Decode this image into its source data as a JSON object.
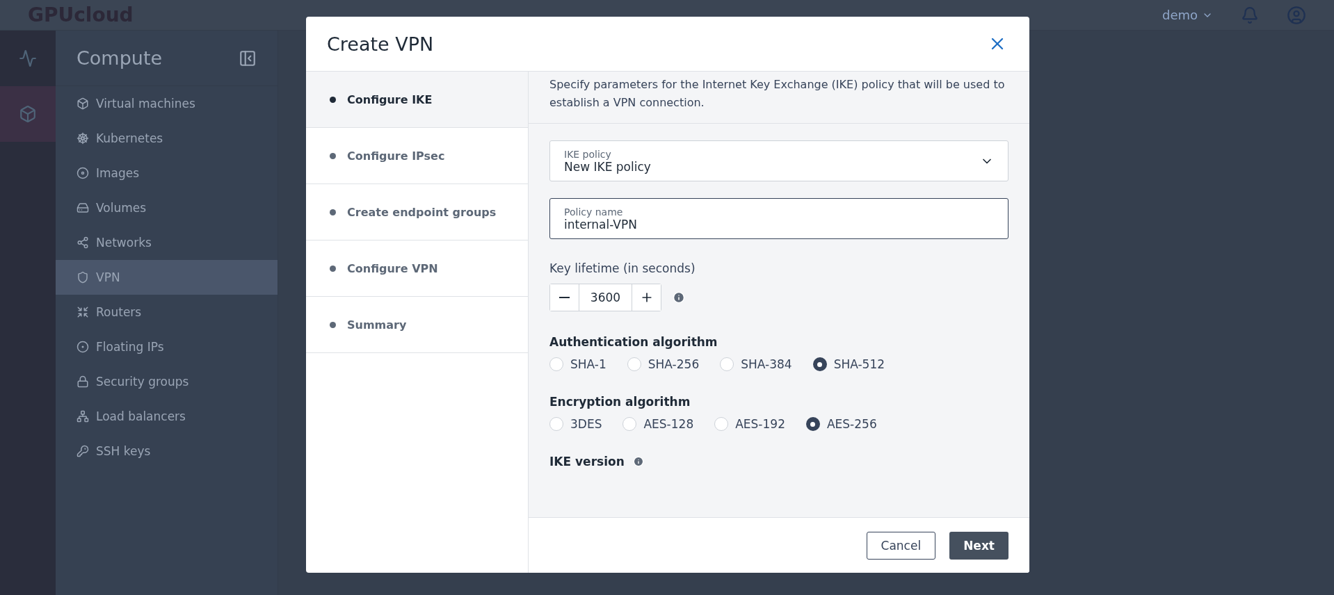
{
  "header": {
    "logo": "GPUcloud",
    "user": "demo"
  },
  "rail": [
    {
      "selected": false
    },
    {
      "selected": true
    }
  ],
  "nav": {
    "title": "Compute",
    "items": [
      {
        "label": "Virtual machines",
        "selected": false
      },
      {
        "label": "Kubernetes",
        "selected": false
      },
      {
        "label": "Images",
        "selected": false
      },
      {
        "label": "Volumes",
        "selected": false
      },
      {
        "label": "Networks",
        "selected": false
      },
      {
        "label": "VPN",
        "selected": true
      },
      {
        "label": "Routers",
        "selected": false
      },
      {
        "label": "Floating IPs",
        "selected": false
      },
      {
        "label": "Security groups",
        "selected": false
      },
      {
        "label": "Load balancers",
        "selected": false
      },
      {
        "label": "SSH keys",
        "selected": false
      }
    ]
  },
  "modal": {
    "title": "Create VPN",
    "steps": [
      {
        "label": "Configure IKE",
        "selected": true
      },
      {
        "label": "Configure IPsec",
        "selected": false
      },
      {
        "label": "Create endpoint groups",
        "selected": false
      },
      {
        "label": "Configure VPN",
        "selected": false
      },
      {
        "label": "Summary",
        "selected": false
      }
    ],
    "description": "Specify parameters for the Internet Key Exchange (IKE) policy that will be used to establish a VPN connection.",
    "ike_policy": {
      "label": "IKE policy",
      "value": "New IKE policy"
    },
    "policy_name": {
      "label": "Policy name",
      "value": "internal-VPN"
    },
    "key_lifetime": {
      "label": "Key lifetime (in seconds)",
      "value": "3600"
    },
    "authentication": {
      "label": "Authentication algorithm",
      "options": [
        {
          "label": "SHA-1",
          "selected": false
        },
        {
          "label": "SHA-256",
          "selected": false
        },
        {
          "label": "SHA-384",
          "selected": false
        },
        {
          "label": "SHA-512",
          "selected": true
        }
      ]
    },
    "encryption": {
      "label": "Encryption algorithm",
      "options": [
        {
          "label": "3DES",
          "selected": false
        },
        {
          "label": "AES-128",
          "selected": false
        },
        {
          "label": "AES-192",
          "selected": false
        },
        {
          "label": "AES-256",
          "selected": true
        }
      ]
    },
    "ike_version": {
      "label": "IKE version"
    },
    "buttons": {
      "cancel": "Cancel",
      "next": "Next"
    }
  }
}
